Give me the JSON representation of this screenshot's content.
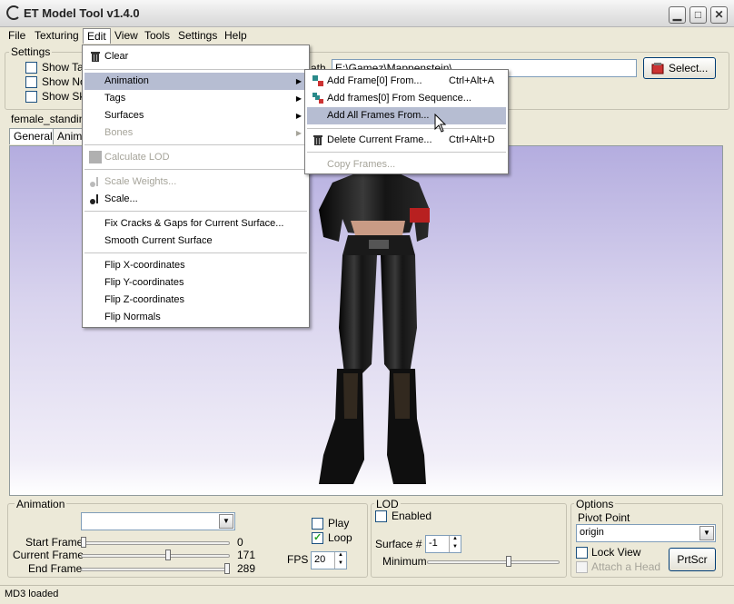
{
  "window": {
    "title": "ET Model Tool v1.4.0",
    "min_glyph": "▁",
    "max_glyph": "□",
    "close_glyph": "✕"
  },
  "menubar": {
    "file": "File",
    "texturing": "Texturing",
    "edit": "Edit",
    "view": "View",
    "tools": "Tools",
    "settings": "Settings",
    "help": "Help"
  },
  "settings_group": {
    "label": "Settings",
    "show1": "Show Ta",
    "show2": "Show No",
    "show3": "Show Sk",
    "path_label": "ath",
    "path_value": "E:\\Gamez\\Mappenstein\\",
    "select_button": "Select..."
  },
  "model": {
    "name": "female_standing",
    "tab_general": "General",
    "tab_animation": "Anima"
  },
  "edit_menu": {
    "clear": "Clear",
    "animation": "Animation",
    "tags": "Tags",
    "surfaces": "Surfaces",
    "bones": "Bones",
    "calculate_lod": "Calculate LOD",
    "scale_weights": "Scale Weights...",
    "scale": "Scale...",
    "fix_cracks": "Fix Cracks & Gaps for Current Surface...",
    "smooth_surface": "Smooth Current Surface",
    "flip_x": "Flip X-coordinates",
    "flip_y": "Flip Y-coordinates",
    "flip_z": "Flip Z-coordinates",
    "flip_normals": "Flip Normals"
  },
  "animation_submenu": {
    "add_frame": "Add Frame[0] From...",
    "add_frame_shortcut": "Ctrl+Alt+A",
    "add_frames_sequence": "Add frames[0] From Sequence...",
    "add_all_frames": "Add All Frames From...",
    "delete_frame": "Delete Current Frame...",
    "delete_frame_shortcut": "Ctrl+Alt+D",
    "copy_frames": "Copy Frames..."
  },
  "animation_panel": {
    "label": "Animation",
    "dropdown_value": "",
    "start_frame_label": "Start Frame",
    "start_frame_value": "0",
    "current_frame_label": "Current Frame",
    "current_frame_value": "171",
    "end_frame_label": "End Frame",
    "end_frame_value": "289",
    "play_label": "Play",
    "play_checked": false,
    "loop_label": "Loop",
    "loop_checked": true,
    "fps_label": "FPS",
    "fps_value": "20",
    "current_frame_fraction": 0.59
  },
  "lod_panel": {
    "label": "LOD",
    "enabled_label": "Enabled",
    "surface_label": "Surface #",
    "surface_value": "-1",
    "minimum_label": "Minimum",
    "minimum_fraction": 0.62
  },
  "options_panel": {
    "label": "Options",
    "pivot_label": "Pivot Point",
    "pivot_value": "origin",
    "lock_view_label": "Lock View",
    "attach_head_label": "Attach a Head",
    "prtscr_button": "PrtScr"
  },
  "status": {
    "text": "MD3 loaded"
  },
  "colors": {
    "menu_highlight": "#b6bdd2",
    "viewport_top": "#b4addf",
    "viewport_bottom": "#ffffff"
  }
}
